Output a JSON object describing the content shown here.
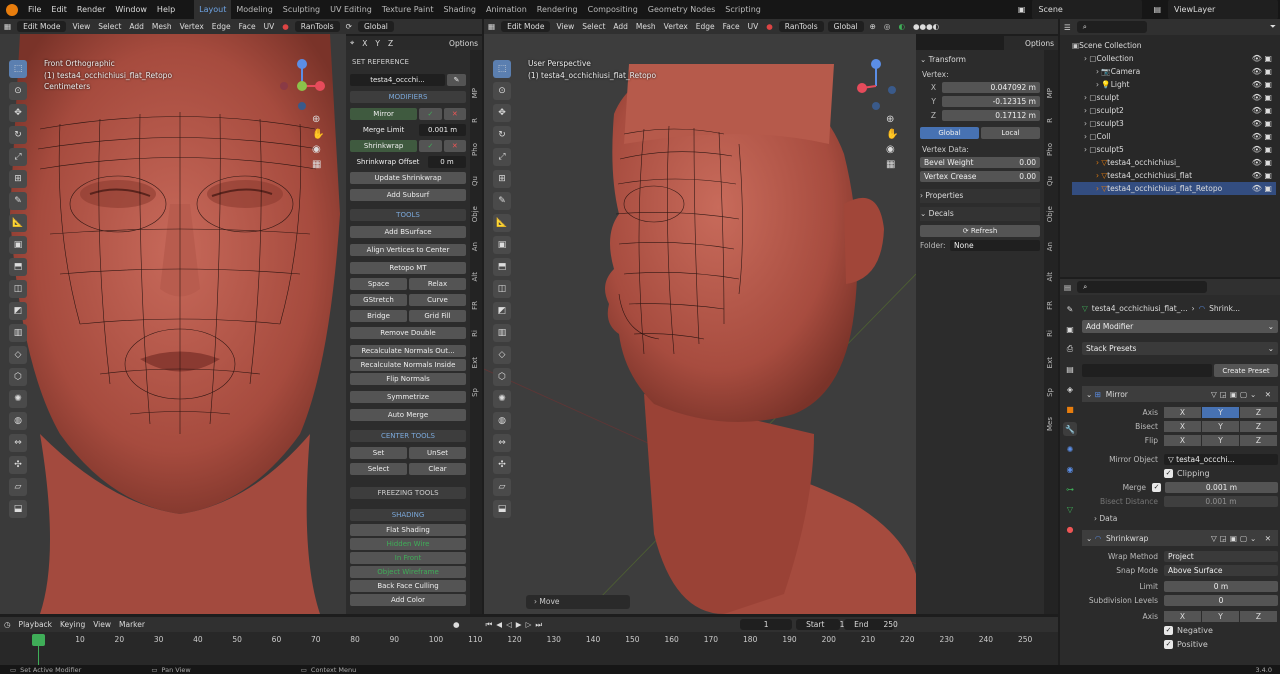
{
  "menu": [
    "File",
    "Edit",
    "Render",
    "Window",
    "Help"
  ],
  "workspaces": [
    "Layout",
    "Modeling",
    "Sculpting",
    "UV Editing",
    "Texture Paint",
    "Shading",
    "Animation",
    "Rendering",
    "Compositing",
    "Geometry Nodes",
    "Scripting"
  ],
  "scene": "Scene",
  "view_layer": "ViewLayer",
  "left_vp": {
    "mode": "Edit Mode",
    "menus": [
      "View",
      "Select",
      "Add",
      "Mesh",
      "Vertex",
      "Edge",
      "Face",
      "UV"
    ],
    "rantools": "RanTools",
    "orient": "Global",
    "xyz": [
      "X",
      "Y",
      "Z"
    ],
    "options": "Options",
    "info": [
      "Front Orthographic",
      "(1) testa4_occhichiusi_flat_Retopo",
      "Centimeters"
    ]
  },
  "right_vp": {
    "mode": "Edit Mode",
    "menus": [
      "View",
      "Select",
      "Add",
      "Mesh",
      "Vertex",
      "Edge",
      "Face",
      "UV"
    ],
    "rantools": "RanTools",
    "orient": "Global",
    "options": "Options",
    "info": [
      "User Perspective",
      "(1) testa4_occhichiusi_flat_Retopo"
    ],
    "move": "Move"
  },
  "npanel_left": {
    "set_reference": "SET REFERENCE",
    "ref_obj": "testa4_occchi...",
    "modifiers": "MODIFIERS",
    "mirror": "Mirror",
    "merge_limit_label": "Merge Limit",
    "merge_limit_val": "0.001 m",
    "shrinkwrap": "Shrinkwrap",
    "sw_offset_label": "Shrinkwrap Offset",
    "sw_offset_val": "0 m",
    "update_sw": "Update Shrinkwrap",
    "add_subsurf": "Add Subsurf",
    "tools": "TOOLS",
    "add_bsurface": "Add BSurface",
    "align_vertices": "Align Vertices to Center",
    "retopo_mt": "Retopo MT",
    "space": "Space",
    "relax": "Relax",
    "gstretch": "GStretch",
    "curve": "Curve",
    "bridge": "Bridge",
    "grid_fill": "Grid Fill",
    "remove_double": "Remove Double",
    "recalc_out": "Recalculate Normals Out...",
    "recalc_in": "Recalculate Normals Inside",
    "flip_normals": "Flip Normals",
    "symmetrize": "Symmetrize",
    "auto_merge": "Auto Merge",
    "center_tools": "CENTER TOOLS",
    "set": "Set",
    "unset": "UnSet",
    "select": "Select",
    "clear": "Clear",
    "freezing_tools": "FREEZING TOOLS",
    "shading": "SHADING",
    "flat_shading": "Flat Shading",
    "hidden_wire": "Hidden Wire",
    "in_front": "In Front",
    "object_wireframe": "Object Wireframe",
    "back_face_culling": "Back Face Culling",
    "add_color": "Add Color",
    "tabs": [
      "MP",
      "R",
      "Pho",
      "Qu",
      "Obje",
      "An",
      "Alt",
      "FR",
      "Ri",
      "Ext",
      "Sp"
    ]
  },
  "npanel_right": {
    "transform": "Transform",
    "vertex_label": "Vertex:",
    "x_label": "X",
    "x_val": "0.047092 m",
    "y_label": "Y",
    "y_val": "-0.12315 m",
    "z_label": "Z",
    "z_val": "0.17112 m",
    "global": "Global",
    "local": "Local",
    "vertex_data": "Vertex Data:",
    "bevel_weight_label": "Bevel Weight",
    "bevel_weight_val": "0.00",
    "vertex_crease_label": "Vertex Crease",
    "vertex_crease_val": "0.00",
    "properties": "Properties",
    "decals": "Decals",
    "refresh": "Refresh",
    "folder_label": "Folder:",
    "folder_val": "None",
    "tabs": [
      "MP",
      "R",
      "Pho",
      "Qu",
      "Obje",
      "An",
      "Alt",
      "FR",
      "Ri",
      "Ext",
      "Sp",
      "Mes"
    ]
  },
  "outliner": {
    "items": [
      {
        "label": "Scene Collection",
        "indent": 0
      },
      {
        "label": "Collection",
        "indent": 1
      },
      {
        "label": "Camera",
        "indent": 2
      },
      {
        "label": "Light",
        "indent": 2
      },
      {
        "label": "sculpt",
        "indent": 1
      },
      {
        "label": "sculpt2",
        "indent": 1
      },
      {
        "label": "sculpt3",
        "indent": 1
      },
      {
        "label": "Coll",
        "indent": 1
      },
      {
        "label": "sculpt5",
        "indent": 1
      },
      {
        "label": "testa4_occhichiusi_",
        "indent": 2
      },
      {
        "label": "testa4_occhichiusi_flat",
        "indent": 2
      },
      {
        "label": "testa4_occhichiusi_flat_Retopo",
        "indent": 2
      }
    ]
  },
  "properties": {
    "breadcrumb_obj": "testa4_occhichiusi_flat_...",
    "breadcrumb_mod": "Shrink...",
    "add_modifier": "Add Modifier",
    "stack_presets": "Stack Presets",
    "create_preset": "Create Preset",
    "mirror": {
      "name": "Mirror",
      "axis_label": "Axis",
      "bisect_label": "Bisect",
      "flip_label": "Flip",
      "xyz": [
        "X",
        "Y",
        "Z"
      ],
      "mirror_object_label": "Mirror Object",
      "mirror_object_val": "testa4_occchi...",
      "clipping": "Clipping",
      "merge_label": "Merge",
      "merge_val": "0.001 m",
      "bisect_distance_label": "Bisect Distance",
      "bisect_distance_val": "0.001 m",
      "data": "Data"
    },
    "shrinkwrap": {
      "name": "Shrinkwrap",
      "wrap_method_label": "Wrap Method",
      "wrap_method_val": "Project",
      "snap_mode_label": "Snap Mode",
      "snap_mode_val": "Above Surface",
      "limit_label": "Limit",
      "limit_val": "0 m",
      "subdiv_label": "Subdivision Levels",
      "subdiv_val": "0",
      "axis_label": "Axis",
      "negative": "Negative",
      "positive": "Positive"
    }
  },
  "timeline": {
    "playback": "Playback",
    "keying": "Keying",
    "view": "View",
    "marker": "Marker",
    "current": "1",
    "start_label": "Start",
    "start_val": "1",
    "end_label": "End",
    "end_val": "250",
    "ticks": [
      "1",
      "10",
      "20",
      "30",
      "40",
      "50",
      "60",
      "70",
      "80",
      "90",
      "100",
      "110",
      "120",
      "130",
      "140",
      "150",
      "160",
      "170",
      "180",
      "190",
      "200",
      "210",
      "220",
      "230",
      "240",
      "250"
    ]
  },
  "status": {
    "a": "Set Active Modifier",
    "b": "Pan View",
    "c": "Context Menu",
    "version": "3.4.0"
  },
  "colors": {
    "accent": "#5b7fb0",
    "skin": "#b8584a",
    "bg": "#3d3d3d"
  }
}
